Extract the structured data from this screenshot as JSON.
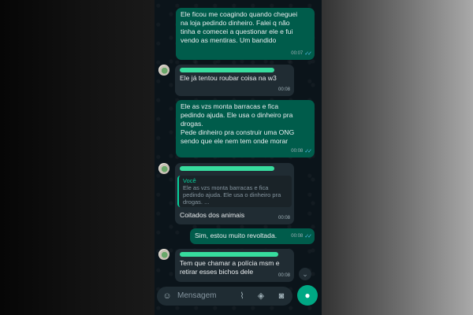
{
  "colors": {
    "outgoing_bubble": "#005c4b",
    "incoming_bubble": "#202c33",
    "accent": "#00a884",
    "read_ticks": "#53bdeb"
  },
  "messages": [
    {
      "direction": "outgoing",
      "text": "Ele ficou me coagindo quando cheguei\nna loja pedindo dinheiro. Falei q não\ntinha e comecei a questionar ele e fui\nvendo as mentiras. Um bandido",
      "time": "00:07",
      "status": "read"
    },
    {
      "direction": "incoming",
      "sender_redacted": true,
      "text": "Ele já tentou roubar coisa na w3",
      "time": "00:08"
    },
    {
      "direction": "outgoing",
      "text": "Ele as vzs monta barracas e fica\npedindo ajuda. Ele usa o dinheiro pra\ndrogas.\nPede dinheiro pra construir uma ONG\nsendo que ele nem tem onde morar",
      "time": "00:08",
      "status": "read"
    },
    {
      "direction": "incoming",
      "sender_redacted": true,
      "quote": {
        "sender": "Você",
        "text": "Ele as vzs monta barracas e fica\npedindo ajuda. Ele usa o dinheiro pra\ndrogas. ..."
      },
      "text": "Coitados dos animais",
      "time": "00:08"
    },
    {
      "direction": "outgoing",
      "text": "Sim, estou muito revoltada.",
      "time": "00:08",
      "status": "read"
    },
    {
      "direction": "incoming",
      "sender_redacted": true,
      "text": "Tem que chamar a polícia msm e\nretirar esses bichos dele",
      "time": "00:08"
    }
  ],
  "composer": {
    "placeholder": "Mensagem",
    "icons": [
      "emoji-icon",
      "attach-icon",
      "payment-icon",
      "camera-icon",
      "mic-icon"
    ]
  },
  "scroll_button_icon": "chevron-down-icon"
}
